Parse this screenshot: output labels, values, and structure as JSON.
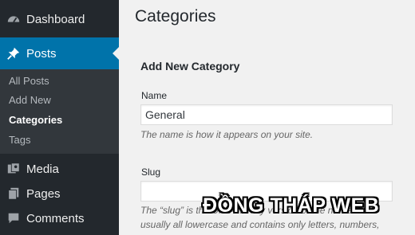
{
  "sidebar": {
    "dashboard": {
      "label": "Dashboard",
      "icon": "dashboard-icon"
    },
    "posts": {
      "label": "Posts",
      "icon": "pin-icon"
    },
    "submenu": [
      "All Posts",
      "Add New",
      "Categories",
      "Tags"
    ],
    "media": {
      "label": "Media",
      "icon": "media-icon"
    },
    "pages": {
      "label": "Pages",
      "icon": "pages-icon"
    },
    "comments": {
      "label": "Comments",
      "icon": "comment-icon"
    }
  },
  "main": {
    "title": "Categories",
    "section_title": "Add New Category",
    "name_label": "Name",
    "name_value": "General",
    "name_description": "The name is how it appears on your site.",
    "slug_label": "Slug",
    "slug_value": "",
    "slug_description": "The “slug” is the URL-friendly version of the name. It is usually all lowercase and contains only letters, numbers, and hyphens."
  },
  "watermark": "ĐỒNG THÁP WEB",
  "colors": {
    "sidebar": "#23282d",
    "submenu": "#32373c",
    "accent": "#0073aa",
    "background": "#f1f1f1"
  }
}
